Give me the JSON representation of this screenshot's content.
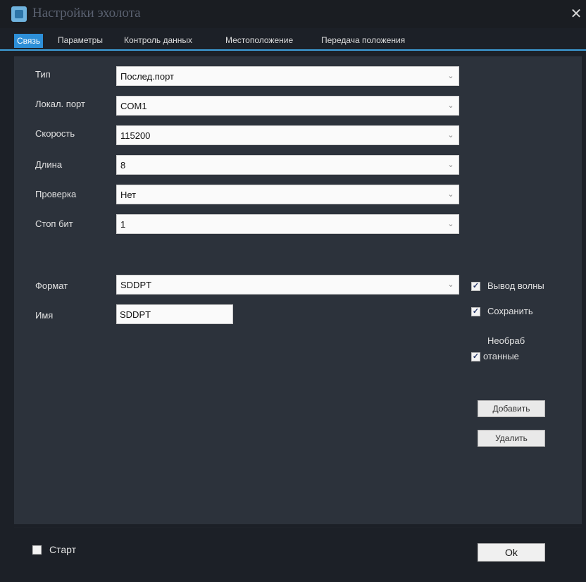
{
  "window": {
    "title": "Настройки эхолота",
    "close_glyph": "✕",
    "icon": "app-icon"
  },
  "tabs": [
    {
      "label": "Связь",
      "active": true
    },
    {
      "label": "Параметры",
      "active": false
    },
    {
      "label": "Контроль данных",
      "active": false
    },
    {
      "label": "Местоположение",
      "active": false
    },
    {
      "label": "Передача положения",
      "active": false
    }
  ],
  "form": {
    "type": {
      "label": "Тип",
      "value": "Послед.порт"
    },
    "local_port": {
      "label": "Локал. порт",
      "value": "COM1"
    },
    "speed": {
      "label": "Скорость",
      "value": "115200"
    },
    "length": {
      "label": "Длина",
      "value": "8"
    },
    "parity": {
      "label": "Проверка",
      "value": "Нет"
    },
    "stop_bits": {
      "label": "Стоп бит",
      "value": "1"
    },
    "format": {
      "label": "Формат",
      "value": "SDDPT"
    },
    "name": {
      "label": "Имя",
      "value": "SDDPT"
    },
    "dropdown_arrow": "⌄"
  },
  "options": {
    "wave_output": {
      "label": "Вывод волны",
      "checked": true
    },
    "save": {
      "label": "Сохранить",
      "checked": true
    },
    "raw_line1": "Необраб",
    "raw_line2": "отанные",
    "raw_checked": true,
    "check_glyph": "✓"
  },
  "buttons": {
    "add": "Добавить",
    "delete": "Удалить",
    "ok": "Ok"
  },
  "footer": {
    "start": {
      "label": "Старт",
      "checked": false
    }
  },
  "colors": {
    "accent": "#2d8fd8",
    "panel": "#2c323b",
    "background": "#1c2027"
  }
}
